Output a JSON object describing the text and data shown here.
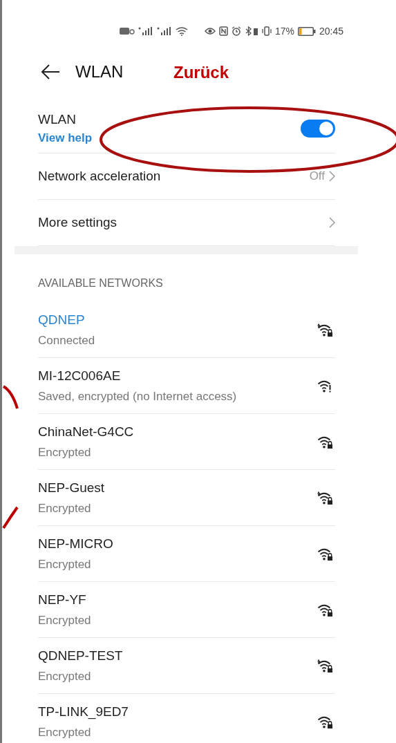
{
  "status_bar": {
    "battery_percent": "17%",
    "time": "20:45"
  },
  "header": {
    "title": "WLAN"
  },
  "annotation": {
    "label": "Zurück"
  },
  "wlan_toggle": {
    "title": "WLAN",
    "help_link": "View help",
    "on": true
  },
  "settings": [
    {
      "label": "Network acceleration",
      "value": "Off"
    },
    {
      "label": "More settings"
    }
  ],
  "section_title": "AVAILABLE NETWORKS",
  "networks": [
    {
      "name": "QDNEP",
      "status": "Connected",
      "connected": true,
      "wifi6": true,
      "kind": "locked"
    },
    {
      "name": "MI-12C006AE",
      "status": "Saved, encrypted (no Internet access)",
      "connected": false,
      "wifi6": false,
      "kind": "alert"
    },
    {
      "name": "ChinaNet-G4CC",
      "status": "Encrypted",
      "connected": false,
      "wifi6": false,
      "kind": "locked"
    },
    {
      "name": "NEP-Guest",
      "status": "Encrypted",
      "connected": false,
      "wifi6": true,
      "kind": "locked"
    },
    {
      "name": "NEP-MICRO",
      "status": "Encrypted",
      "connected": false,
      "wifi6": false,
      "kind": "locked"
    },
    {
      "name": "NEP-YF",
      "status": "Encrypted",
      "connected": false,
      "wifi6": false,
      "kind": "locked"
    },
    {
      "name": "QDNEP-TEST",
      "status": "Encrypted",
      "connected": false,
      "wifi6": true,
      "kind": "locked"
    },
    {
      "name": "TP-LINK_9ED7",
      "status": "Encrypted",
      "connected": false,
      "wifi6": false,
      "kind": "locked"
    }
  ]
}
